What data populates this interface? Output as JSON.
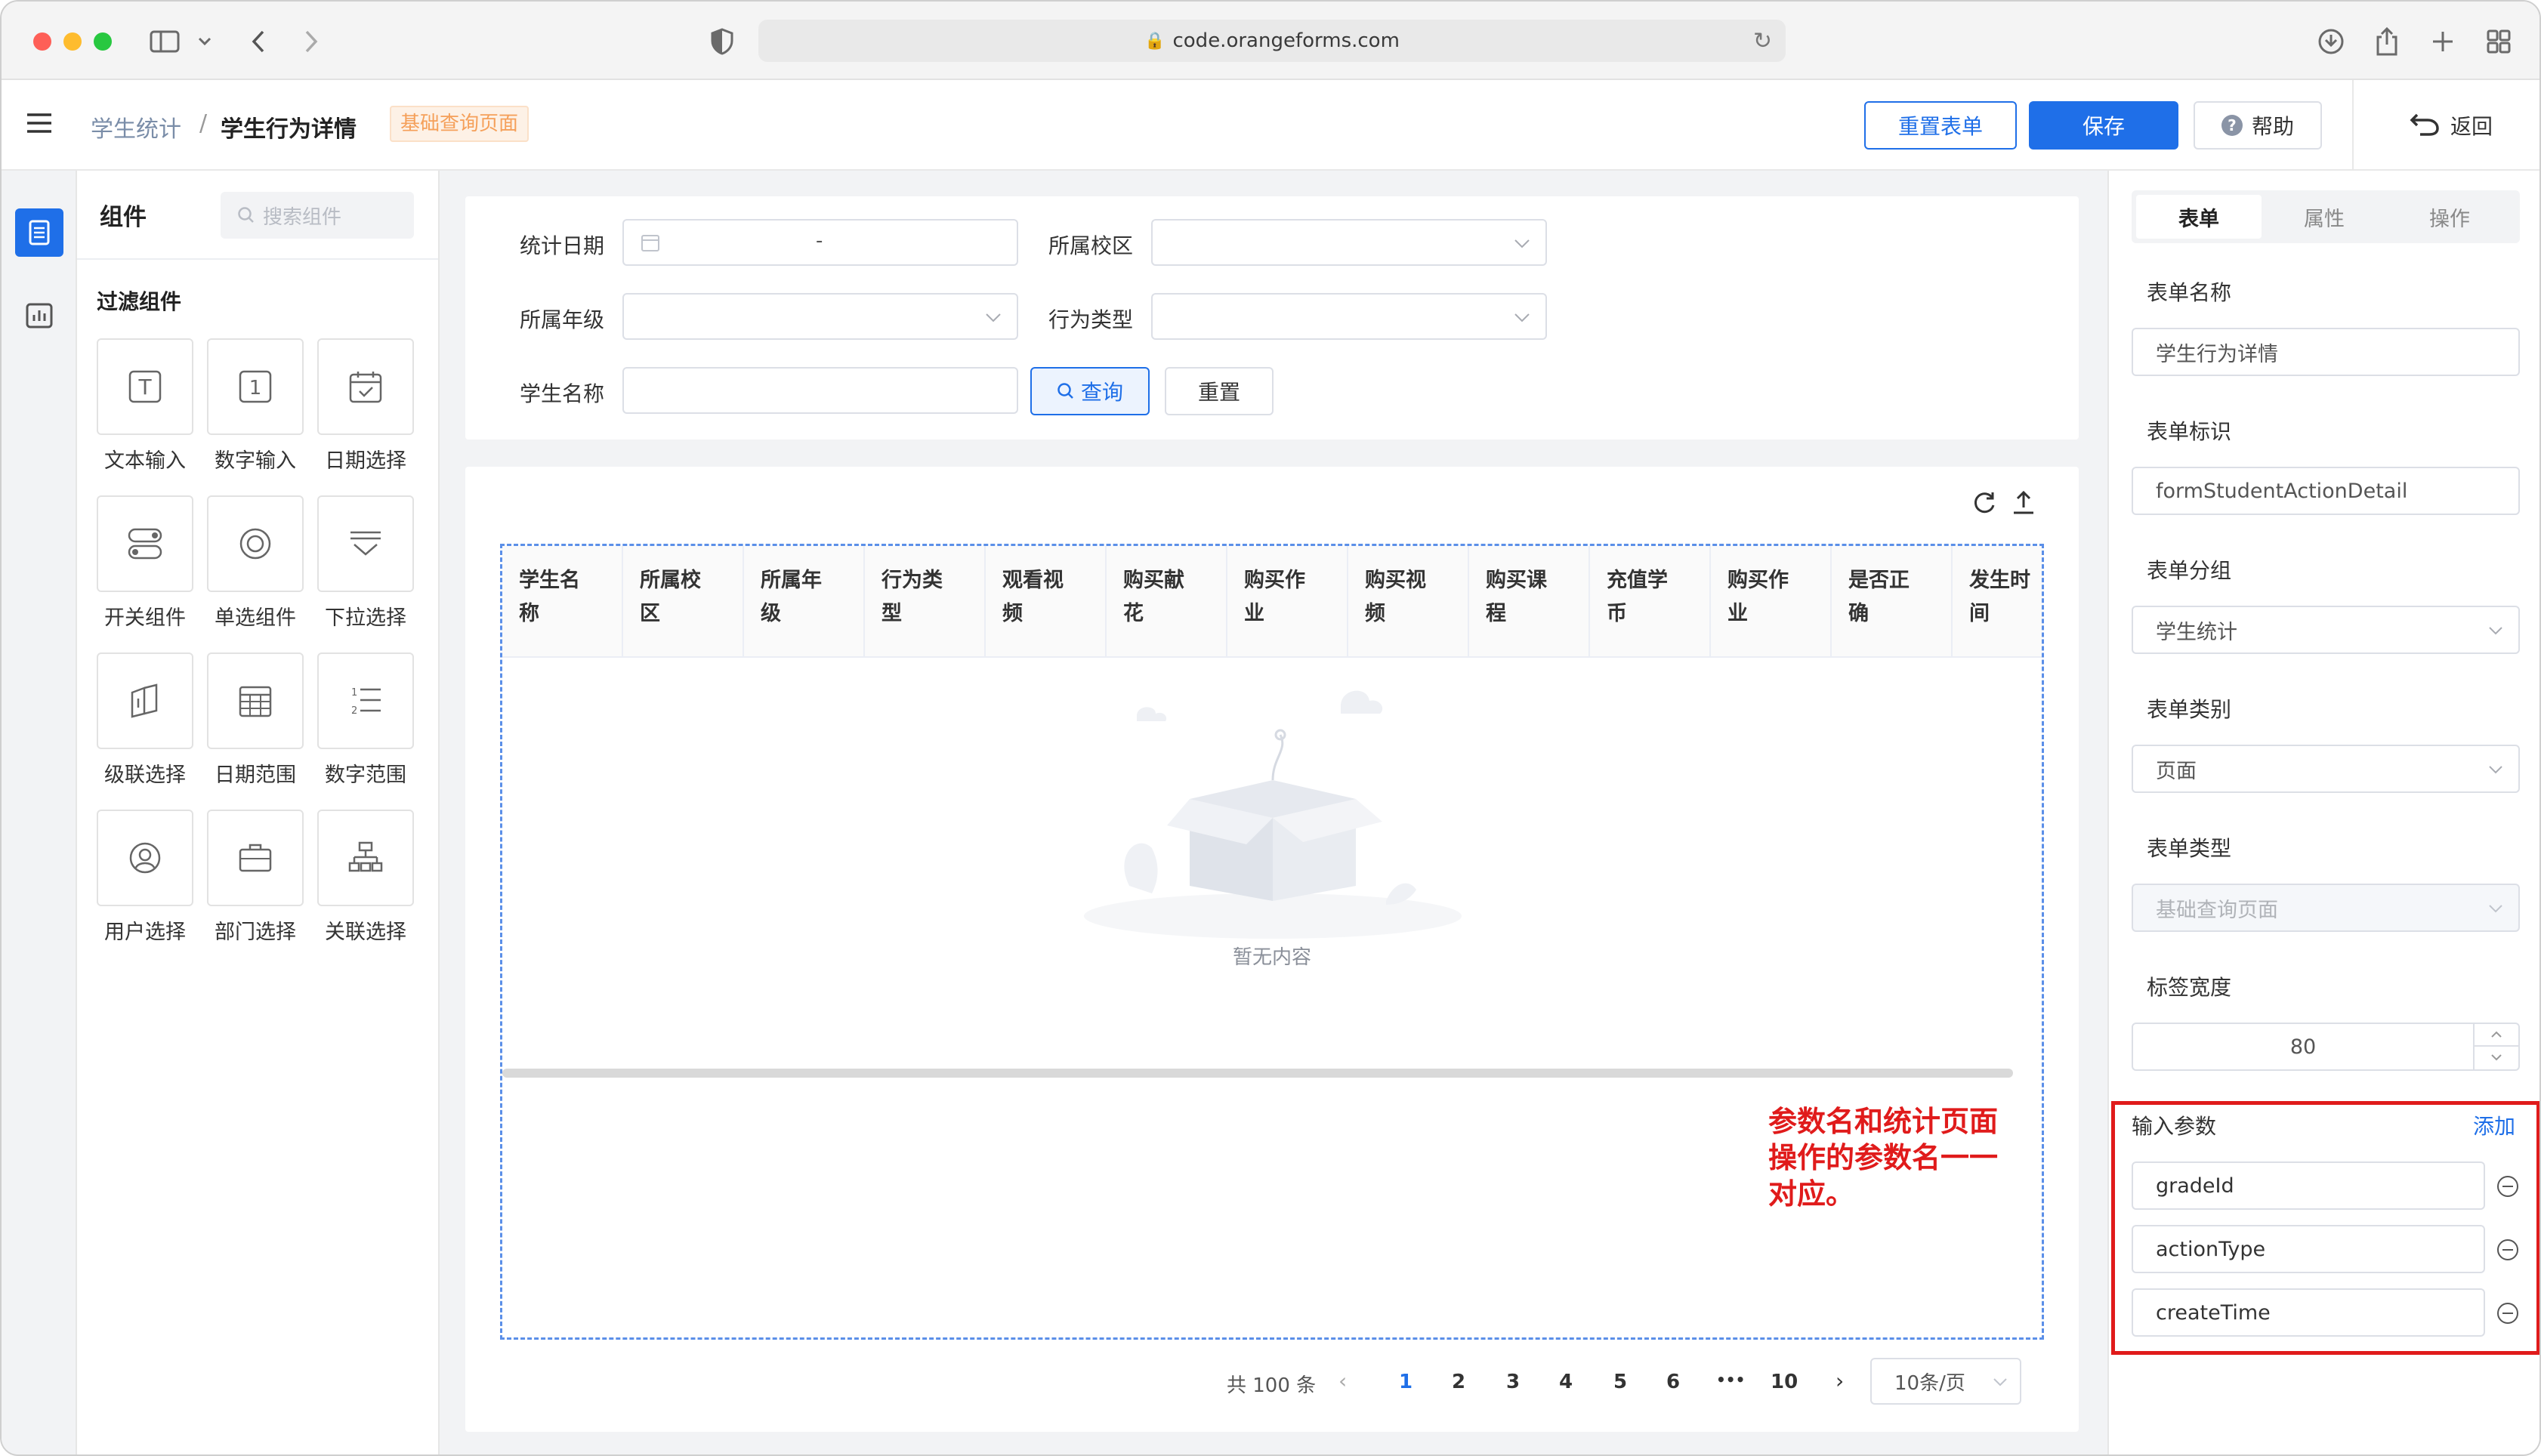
{
  "browser": {
    "url": "code.orangeforms.com"
  },
  "header": {
    "breadcrumb_root": "学生统计",
    "breadcrumb_sep": "/",
    "breadcrumb_current": "学生行为详情",
    "page_tag": "基础查询页面",
    "reset_form": "重置表单",
    "save": "保存",
    "help": "帮助",
    "back": "返回"
  },
  "palette": {
    "title": "组件",
    "search_placeholder": "搜索组件",
    "section": "过滤组件",
    "components": [
      {
        "label": "文本输入",
        "icon": "text-input-icon"
      },
      {
        "label": "数字输入",
        "icon": "number-input-icon"
      },
      {
        "label": "日期选择",
        "icon": "calendar-icon"
      },
      {
        "label": "开关组件",
        "icon": "switch-icon"
      },
      {
        "label": "单选组件",
        "icon": "radio-icon"
      },
      {
        "label": "下拉选择",
        "icon": "dropdown-icon"
      },
      {
        "label": "级联选择",
        "icon": "cascade-icon"
      },
      {
        "label": "日期范围",
        "icon": "date-range-icon"
      },
      {
        "label": "数字范围",
        "icon": "number-range-icon"
      },
      {
        "label": "用户选择",
        "icon": "user-icon"
      },
      {
        "label": "部门选择",
        "icon": "briefcase-icon"
      },
      {
        "label": "关联选择",
        "icon": "org-tree-icon"
      }
    ]
  },
  "filters": {
    "stat_date": "统计日期",
    "date_sep": "-",
    "campus": "所属校区",
    "grade": "所属年级",
    "action_type": "行为类型",
    "student_name": "学生名称",
    "query": "查询",
    "reset": "重置"
  },
  "table": {
    "columns": [
      [
        "学生名",
        "称"
      ],
      [
        "所属校",
        "区"
      ],
      [
        "所属年",
        "级"
      ],
      [
        "行为类",
        "型"
      ],
      [
        "观看视",
        "频"
      ],
      [
        "购买献",
        "花"
      ],
      [
        "购买作",
        "业"
      ],
      [
        "购买视",
        "频"
      ],
      [
        "购买课",
        "程"
      ],
      [
        "充值学",
        "币"
      ],
      [
        "购买作",
        "业"
      ],
      [
        "是否正",
        "确"
      ],
      [
        "发生时",
        "间"
      ]
    ],
    "empty_text": "暂无内容",
    "annotation": [
      "参数名和统计页面",
      "操作的参数名一一",
      "对应。"
    ]
  },
  "pagination": {
    "total": "共 100 条",
    "pages": [
      "1",
      "2",
      "3",
      "4",
      "5",
      "6",
      "•••",
      "10"
    ],
    "current": "1",
    "page_size": "10条/页"
  },
  "props": {
    "tabs": [
      "表单",
      "属性",
      "操作"
    ],
    "form_name_label": "表单名称",
    "form_name": "学生行为详情",
    "form_id_label": "表单标识",
    "form_id": "formStudentActionDetail",
    "form_group_label": "表单分组",
    "form_group": "学生统计",
    "form_category_label": "表单类别",
    "form_category": "页面",
    "form_type_label": "表单类型",
    "form_type": "基础查询页面",
    "label_width_label": "标签宽度",
    "label_width": "80",
    "input_params_label": "输入参数",
    "add": "添加",
    "params": [
      "gradeId",
      "actionType",
      "createTime"
    ]
  },
  "colors": {
    "primary": "#1f6fe8",
    "tag": "#f5a05a",
    "annotation_red": "#e01b1b"
  }
}
